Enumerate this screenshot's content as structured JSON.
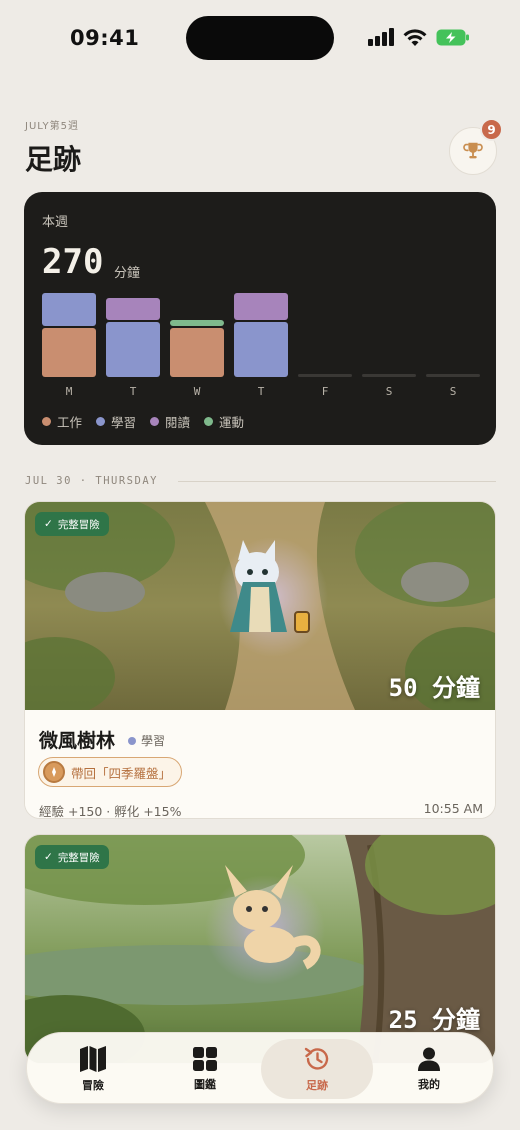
{
  "status_bar": {
    "time": "09:41"
  },
  "header": {
    "week_label": "JULY第5週",
    "title": "足跡",
    "trophy_badge_count": "9"
  },
  "weekly_summary": {
    "label": "本週",
    "total": "270",
    "unit": "分鐘",
    "days": [
      "M",
      "T",
      "W",
      "T",
      "F",
      "S",
      "S"
    ],
    "legend": [
      {
        "name": "工作",
        "color": "#c98e70"
      },
      {
        "name": "學習",
        "color": "#8a95cc"
      },
      {
        "name": "閱讀",
        "color": "#a784bb"
      },
      {
        "name": "運動",
        "color": "#7fb98c"
      }
    ]
  },
  "chart_data": {
    "type": "bar",
    "stacked": true,
    "categories": [
      "M",
      "T",
      "W",
      "T",
      "F",
      "S",
      "S"
    ],
    "series": [
      {
        "name": "工作",
        "values": [
          45,
          0,
          45,
          0,
          0,
          0,
          0
        ]
      },
      {
        "name": "學習",
        "values": [
          30,
          50,
          0,
          50,
          0,
          0,
          0
        ]
      },
      {
        "name": "閱讀",
        "values": [
          0,
          20,
          0,
          25,
          0,
          0,
          0
        ]
      },
      {
        "name": "運動",
        "values": [
          0,
          0,
          5,
          0,
          0,
          0,
          0
        ]
      }
    ],
    "legend_position": "bottom-left"
  },
  "date_divider": "JUL 30 · THURSDAY",
  "adventures": [
    {
      "status": "完整冒險",
      "minutes": "50 分鐘",
      "name": "微風樹林",
      "category": "學習",
      "reward": "帶回「四季羅盤」",
      "stats": "經驗 +150 · 孵化 +15%",
      "time": "10:55 AM"
    },
    {
      "status": "完整冒險",
      "minutes": "25 分鐘"
    }
  ],
  "tabbar": {
    "tabs": [
      {
        "label": "冒險",
        "icon": "map-icon"
      },
      {
        "label": "圖鑑",
        "icon": "grid-icon"
      },
      {
        "label": "足跡",
        "icon": "history-icon"
      },
      {
        "label": "我的",
        "icon": "person-icon"
      }
    ],
    "active": "足跡"
  }
}
